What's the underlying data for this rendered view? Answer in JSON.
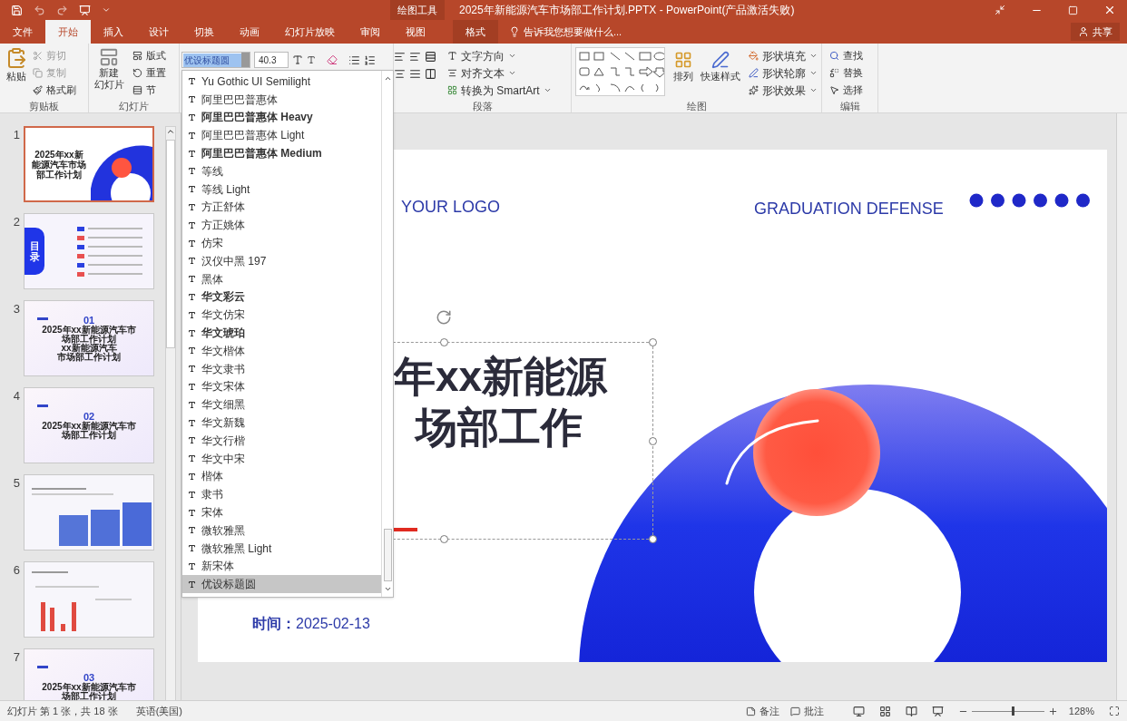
{
  "title_bar": {
    "context_label": "绘图工具",
    "title": "2025年新能源汽车市场部工作计划.PPTX - PowerPoint(产品激活失败)"
  },
  "tabs": [
    {
      "label": "文件",
      "selected": false,
      "kind": "file"
    },
    {
      "label": "开始",
      "selected": true,
      "kind": "tab"
    },
    {
      "label": "插入",
      "selected": false,
      "kind": "tab"
    },
    {
      "label": "设计",
      "selected": false,
      "kind": "tab"
    },
    {
      "label": "切换",
      "selected": false,
      "kind": "tab"
    },
    {
      "label": "动画",
      "selected": false,
      "kind": "tab"
    },
    {
      "label": "幻灯片放映",
      "selected": false,
      "kind": "tab"
    },
    {
      "label": "审阅",
      "selected": false,
      "kind": "tab"
    },
    {
      "label": "视图",
      "selected": false,
      "kind": "tab"
    },
    {
      "label": "格式",
      "selected": false,
      "kind": "context"
    }
  ],
  "tell_me": "告诉我您想要做什么...",
  "share": "共享",
  "ribbon": {
    "clipboard": {
      "label": "剪贴板",
      "paste": "粘贴",
      "cut": "剪切",
      "copy": "复制",
      "painter": "格式刷"
    },
    "slides": {
      "label": "幻灯片",
      "new_slide": [
        "新建",
        "幻灯片"
      ],
      "layout": "版式",
      "reset": "重置",
      "section": "节"
    },
    "font": {
      "name": "优设标题圆",
      "size": "40.3"
    },
    "paragraph": {
      "label": "段落",
      "text_direction": "文字方向",
      "align_text": "对齐文本",
      "smartart": "转换为 SmartArt"
    },
    "drawing": {
      "label": "绘图",
      "arrange": "排列",
      "quick_styles": "快速样式",
      "fill": "形状填充",
      "outline": "形状轮廓",
      "effects": "形状效果"
    },
    "editing": {
      "label": "编辑",
      "find": "查找",
      "replace": "替换",
      "select": "选择"
    }
  },
  "font_list": [
    {
      "name": "Yu Gothic UI Semilight",
      "bold": false,
      "selected": false
    },
    {
      "name": "阿里巴巴普惠体",
      "bold": false,
      "selected": false
    },
    {
      "name": "阿里巴巴普惠体 Heavy",
      "bold": true,
      "selected": false
    },
    {
      "name": "阿里巴巴普惠体 Light",
      "bold": false,
      "selected": false
    },
    {
      "name": "阿里巴巴普惠体 Medium",
      "bold": true,
      "selected": false
    },
    {
      "name": "等线",
      "bold": false,
      "selected": false
    },
    {
      "name": "等线 Light",
      "bold": false,
      "selected": false
    },
    {
      "name": "方正舒体",
      "bold": false,
      "selected": false
    },
    {
      "name": "方正姚体",
      "bold": false,
      "selected": false
    },
    {
      "name": "仿宋",
      "bold": false,
      "selected": false
    },
    {
      "name": "汉仪中黑 197",
      "bold": false,
      "selected": false
    },
    {
      "name": "黑体",
      "bold": false,
      "selected": false
    },
    {
      "name": "华文彩云",
      "bold": true,
      "selected": false
    },
    {
      "name": "华文仿宋",
      "bold": false,
      "selected": false
    },
    {
      "name": "华文琥珀",
      "bold": true,
      "selected": false
    },
    {
      "name": "华文楷体",
      "bold": false,
      "selected": false
    },
    {
      "name": "华文隶书",
      "bold": false,
      "selected": false
    },
    {
      "name": "华文宋体",
      "bold": false,
      "selected": false
    },
    {
      "name": "华文细黑",
      "bold": false,
      "selected": false
    },
    {
      "name": "华文新魏",
      "bold": false,
      "selected": false
    },
    {
      "name": "华文行楷",
      "bold": false,
      "selected": false
    },
    {
      "name": "华文中宋",
      "bold": false,
      "selected": false
    },
    {
      "name": "楷体",
      "bold": false,
      "selected": false
    },
    {
      "name": "隶书",
      "bold": false,
      "selected": false
    },
    {
      "name": "宋体",
      "bold": false,
      "selected": false
    },
    {
      "name": "微软雅黑",
      "bold": false,
      "selected": false
    },
    {
      "name": "微软雅黑 Light",
      "bold": false,
      "selected": false
    },
    {
      "name": "新宋体",
      "bold": false,
      "selected": false
    },
    {
      "name": "优设标题圆",
      "bold": false,
      "selected": true
    }
  ],
  "thumbnails": [
    {
      "number": "1",
      "kind": "cover",
      "selected": true,
      "title": "2025年xx新能源汽车市场部工作计划"
    },
    {
      "number": "2",
      "kind": "contents",
      "selected": false,
      "title": "目录"
    },
    {
      "number": "3",
      "kind": "section",
      "selected": false,
      "section": "01",
      "title": "2025年xx新能源汽车市场部工作计划",
      "subtitle": "xx新能源汽车市场部工作计划"
    },
    {
      "number": "4",
      "kind": "section",
      "selected": false,
      "section": "02",
      "title": "2025年xx新能源汽车市场部工作计划"
    },
    {
      "number": "5",
      "kind": "photos",
      "selected": false
    },
    {
      "number": "6",
      "kind": "chart",
      "selected": false
    },
    {
      "number": "7",
      "kind": "section",
      "selected": false,
      "section": "03",
      "title": "2025年xx新能源汽车市场部工作计划"
    }
  ],
  "slide": {
    "logo": "YOUR LOGO",
    "heading": "GRADUATION DEFENSE",
    "title_lines": [
      "年xx新能源",
      "场部工作"
    ],
    "date_label": "时间：",
    "date": "2025-02-13"
  },
  "status_bar": {
    "slide_info": "幻灯片 第 1 张，共 18 张",
    "language": "英语(美国)",
    "notes": "备注",
    "comments": "批注",
    "zoom": {
      "level": 0.55,
      "reading": "128%"
    }
  }
}
